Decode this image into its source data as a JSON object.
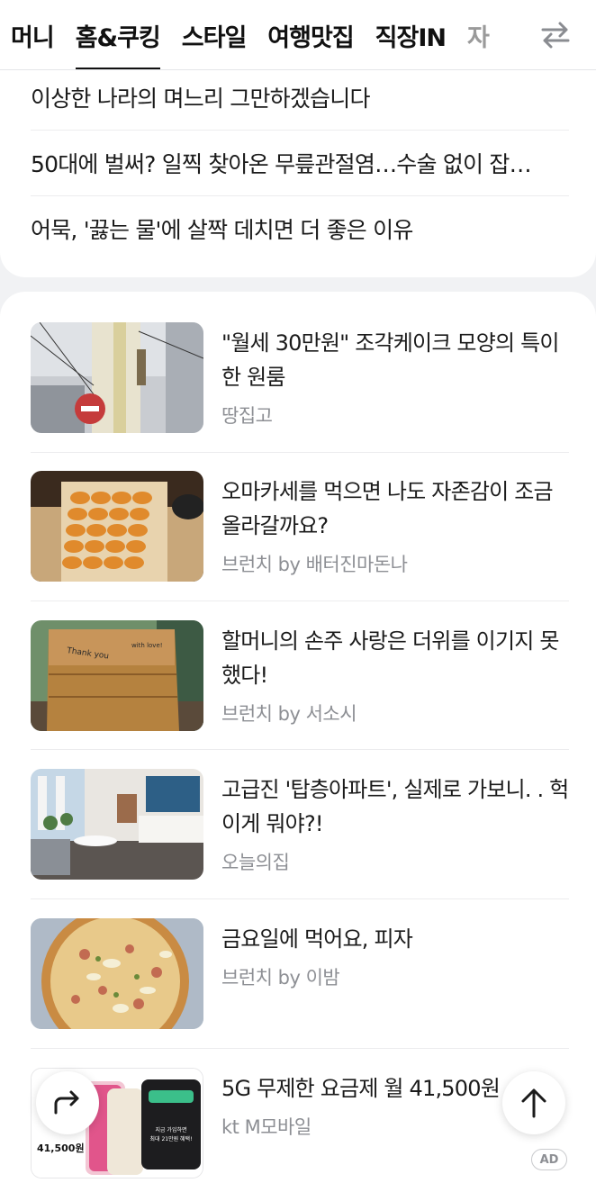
{
  "tabs": [
    {
      "label": "머니",
      "active": false
    },
    {
      "label": "홈&쿠킹",
      "active": true
    },
    {
      "label": "스타일",
      "active": false
    },
    {
      "label": "여행맛집",
      "active": false
    },
    {
      "label": "직장IN",
      "active": false
    },
    {
      "label": "자",
      "active": false
    }
  ],
  "swap_icon": "swap-arrows-icon",
  "headlines": [
    "이상한 나라의 며느리 그만하겠습니다",
    "50대에 벌써? 일찍 찾아온 무릎관절염…수술 없이 잡…",
    "어묵, '끓는 물'에 살짝 데치면 더 좋은 이유"
  ],
  "articles": [
    {
      "title": "\"월세 30만원\" 조각케이크 모양의 특이한 원룸",
      "source": "땅집고",
      "image": "street-building-photo"
    },
    {
      "title": "오마카세를 먹으면 나도 자존감이 조금 올라갈까요?",
      "source": "브런치 by 배터진마돈나",
      "image": "sea-urchin-tray-photo"
    },
    {
      "title": "할머니의 손주 사랑은 더위를 이기지 못했다!",
      "source": "브런치 by 서소시",
      "image": "paper-bag-photo"
    },
    {
      "title": "고급진 '탑층아파트', 실제로 가보니. . 헉 이게 뭐야?!",
      "source": "오늘의집",
      "image": "living-room-photo"
    },
    {
      "title": "금요일에 먹어요, 피자",
      "source": "브런치 by 이밤",
      "image": "pizza-photo"
    },
    {
      "title": "5G 무제한 요금제 월 41,500원",
      "source": "kt M모바일",
      "image": "phone-ad-image"
    }
  ],
  "ad": {
    "badge": "AD",
    "price_text": "41,500원",
    "card_text_1": "지금 가입하면",
    "card_text_2": "최대 21만원 혜택!"
  },
  "bag_text_1": "Thank you",
  "bag_text_2": "with love!",
  "buttons": {
    "share_icon": "share-arrow-icon",
    "top_icon": "arrow-up-icon"
  },
  "colors": {
    "background": "#f1f2f4",
    "card": "#ffffff",
    "text": "#1b1b1b",
    "meta": "#8d8f94"
  }
}
